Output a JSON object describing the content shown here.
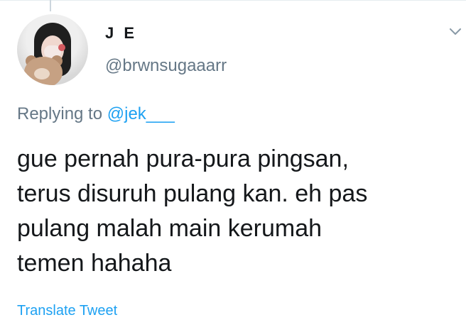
{
  "tweet": {
    "display_name": "J E",
    "username": "@brwnsugaaarr",
    "reply_prefix": "Replying to",
    "reply_handle": "@jek___",
    "text": "gue pernah pura-pura pingsan,\nterus disuruh pulang kan. eh pas\npulang malah main kerumah\ntemen hahaha",
    "translate_label": "Translate Tweet"
  },
  "ui": {
    "icons": {
      "menu": "chevron-down-icon",
      "avatar": "profile-avatar"
    },
    "colors": {
      "text": "#14171a",
      "secondary": "#657786",
      "link": "#1da1f2",
      "divider": "#e6ecf0"
    }
  }
}
